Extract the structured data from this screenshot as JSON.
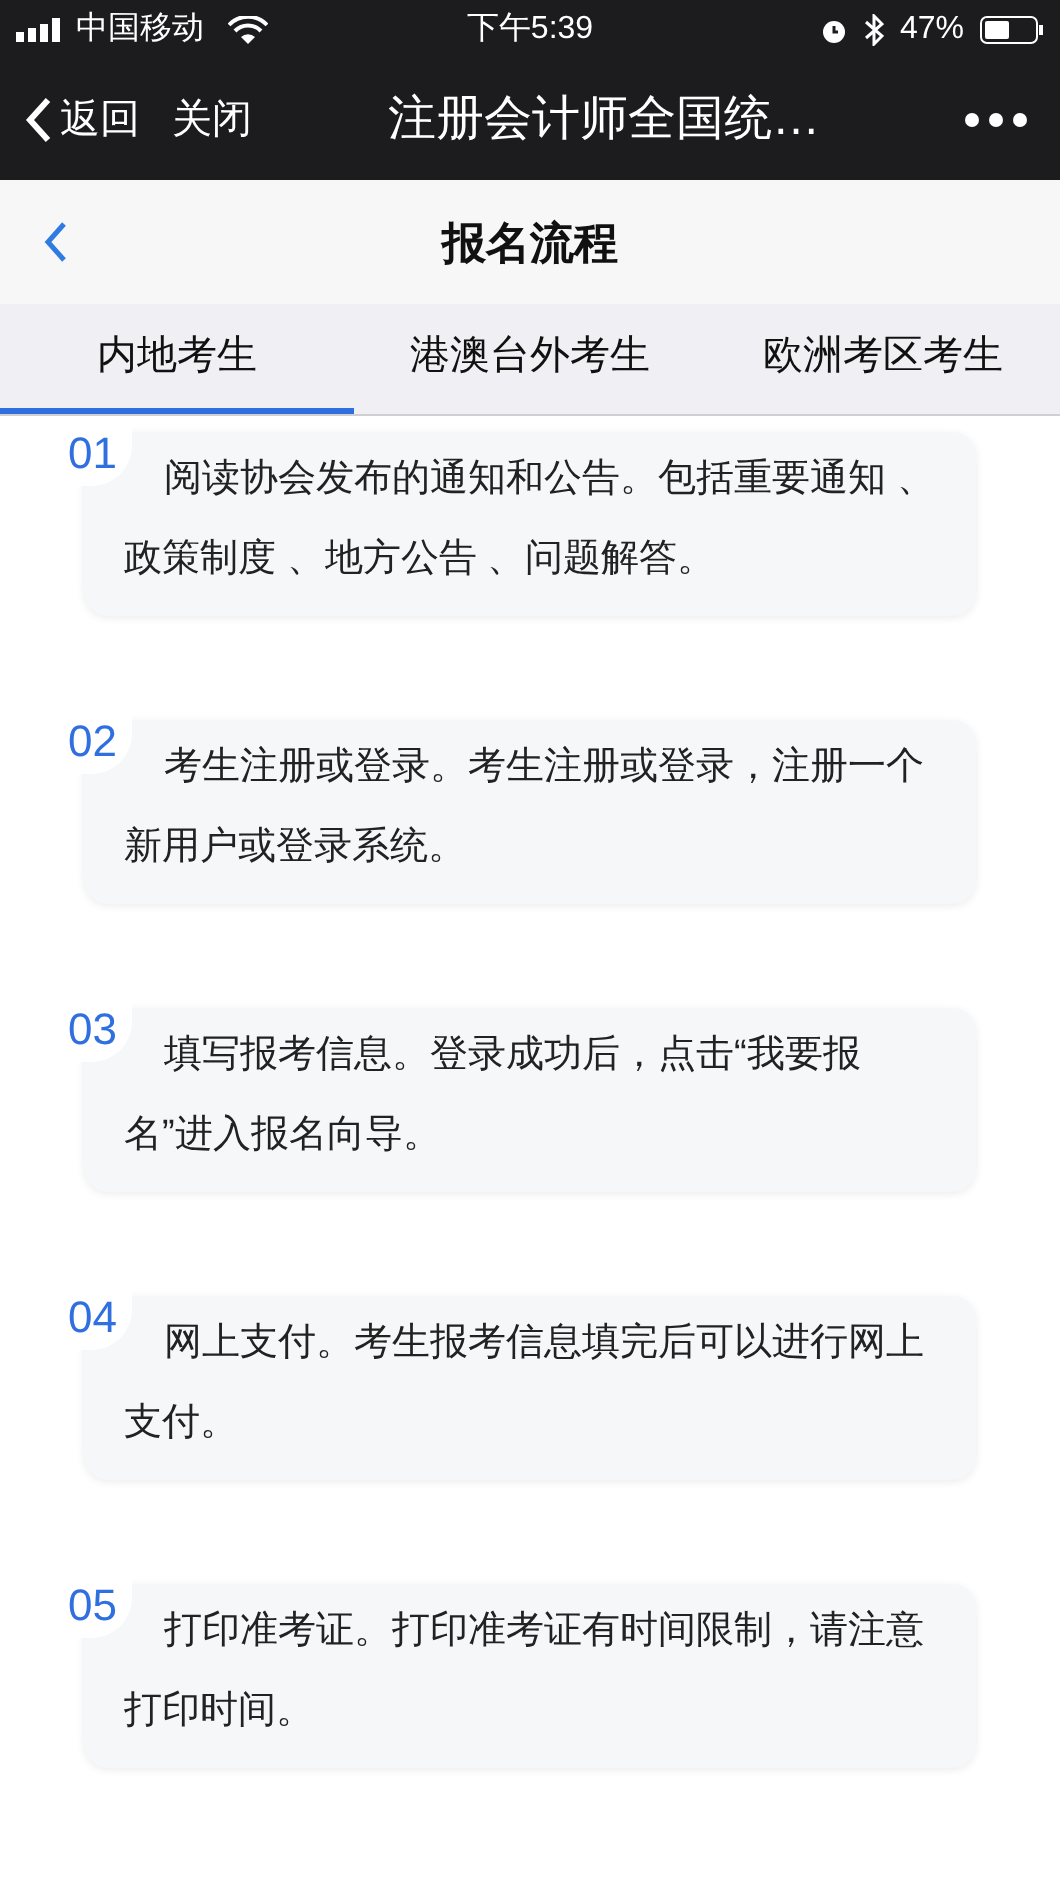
{
  "status_bar": {
    "carrier": "中国移动",
    "time": "下午5:39",
    "battery": "47%"
  },
  "nav_bar": {
    "back": "返回",
    "close": "关闭",
    "title": "注册会计师全国统…"
  },
  "header": {
    "title": "报名流程"
  },
  "tabs": [
    {
      "label": "内地考生",
      "selected": true
    },
    {
      "label": "港澳台外考生",
      "selected": false
    },
    {
      "label": "欧洲考区考生",
      "selected": false
    }
  ],
  "steps": [
    {
      "number": "01",
      "text": "阅读协会发布的通知和公告。包括重要通知 、政策制度 、地方公告 、问题解答。"
    },
    {
      "number": "02",
      "text": "考生注册或登录。考生注册或登录，注册一个新用户或登录系统。"
    },
    {
      "number": "03",
      "text": "填写报考信息。登录成功后，点击“我要报名”进入报名向导。"
    },
    {
      "number": "04",
      "text": "网上支付。考生报考信息填完后可以进行网上支付。"
    },
    {
      "number": "05",
      "text": "打印准考证。打印准考证有时间限制，请注意打印时间。"
    }
  ]
}
